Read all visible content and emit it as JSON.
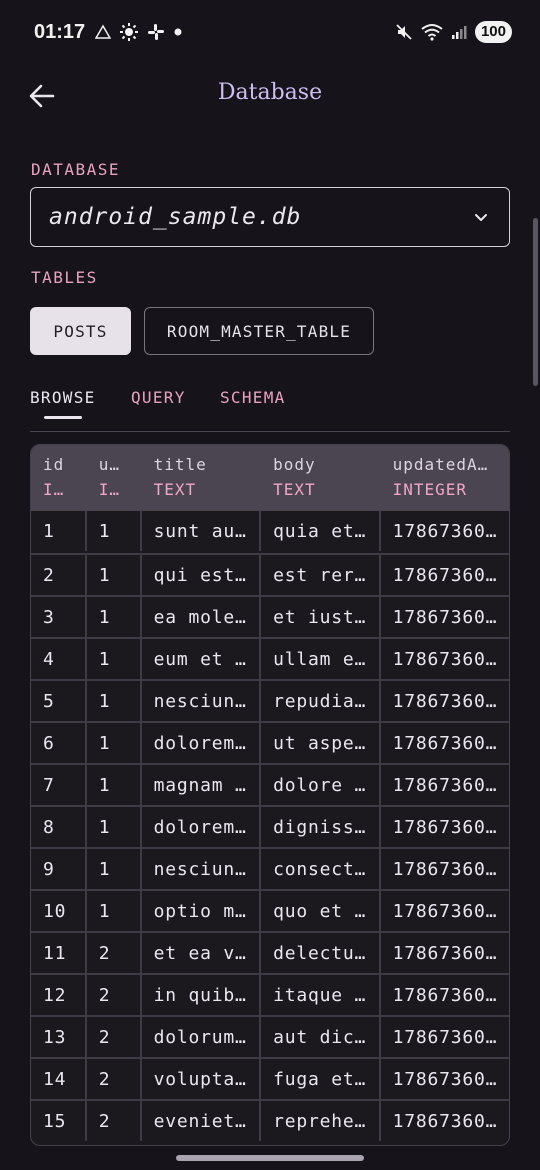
{
  "status_bar": {
    "time": "01:17",
    "left_icons": [
      "warning-triangle-icon",
      "sun-icon",
      "slack-icon",
      "dot-icon"
    ],
    "right_icons": [
      "mute-icon",
      "wifi-icon",
      "signal-icon"
    ],
    "battery": "100"
  },
  "app_bar": {
    "title": "Database",
    "back_icon": "arrow-left-icon"
  },
  "database_section": {
    "label": "DATABASE",
    "selected_db": "android_sample.db"
  },
  "tables_section": {
    "label": "TABLES",
    "chips": [
      {
        "label": "POSTS",
        "selected": true
      },
      {
        "label": "ROOM_MASTER_TABLE",
        "selected": false
      }
    ]
  },
  "tabs": [
    {
      "label": "BROWSE",
      "active": true
    },
    {
      "label": "QUERY",
      "active": false
    },
    {
      "label": "SCHEMA",
      "active": false
    }
  ],
  "table": {
    "columns": [
      {
        "name": "id",
        "type": "I…"
      },
      {
        "name": "u…",
        "type": "I…"
      },
      {
        "name": "title",
        "type": "TEXT"
      },
      {
        "name": "body",
        "type": "TEXT"
      },
      {
        "name": "updatedA…",
        "type": "INTEGER"
      }
    ],
    "rows": [
      [
        "1",
        "1",
        "sunt au…",
        "quia et…",
        "17867360…"
      ],
      [
        "2",
        "1",
        "qui est…",
        "est rer…",
        "17867360…"
      ],
      [
        "3",
        "1",
        "ea mole…",
        "et iust…",
        "17867360…"
      ],
      [
        "4",
        "1",
        "eum et …",
        "ullam e…",
        "17867360…"
      ],
      [
        "5",
        "1",
        "nesciun…",
        "repudia…",
        "17867360…"
      ],
      [
        "6",
        "1",
        "dolorem…",
        "ut aspe…",
        "17867360…"
      ],
      [
        "7",
        "1",
        "magnam …",
        "dolore …",
        "17867360…"
      ],
      [
        "8",
        "1",
        "dolorem…",
        "digniss…",
        "17867360…"
      ],
      [
        "9",
        "1",
        "nesciun…",
        "consect…",
        "17867360…"
      ],
      [
        "10",
        "1",
        "optio m…",
        "quo et …",
        "17867360…"
      ],
      [
        "11",
        "2",
        "et ea v…",
        "delectu…",
        "17867360…"
      ],
      [
        "12",
        "2",
        "in quib…",
        "itaque …",
        "17867360…"
      ],
      [
        "13",
        "2",
        "dolorum…",
        "aut dic…",
        "17867360…"
      ],
      [
        "14",
        "2",
        "volupta…",
        "fuga et…",
        "17867360…"
      ],
      [
        "15",
        "2",
        "eveniet…",
        "reprehe…",
        "17867360…"
      ]
    ]
  },
  "colors": {
    "background": "#16131a",
    "accent_pink": "#e8a2c0",
    "title_lavender": "#cdbef2",
    "header_bg": "#4a4550"
  }
}
